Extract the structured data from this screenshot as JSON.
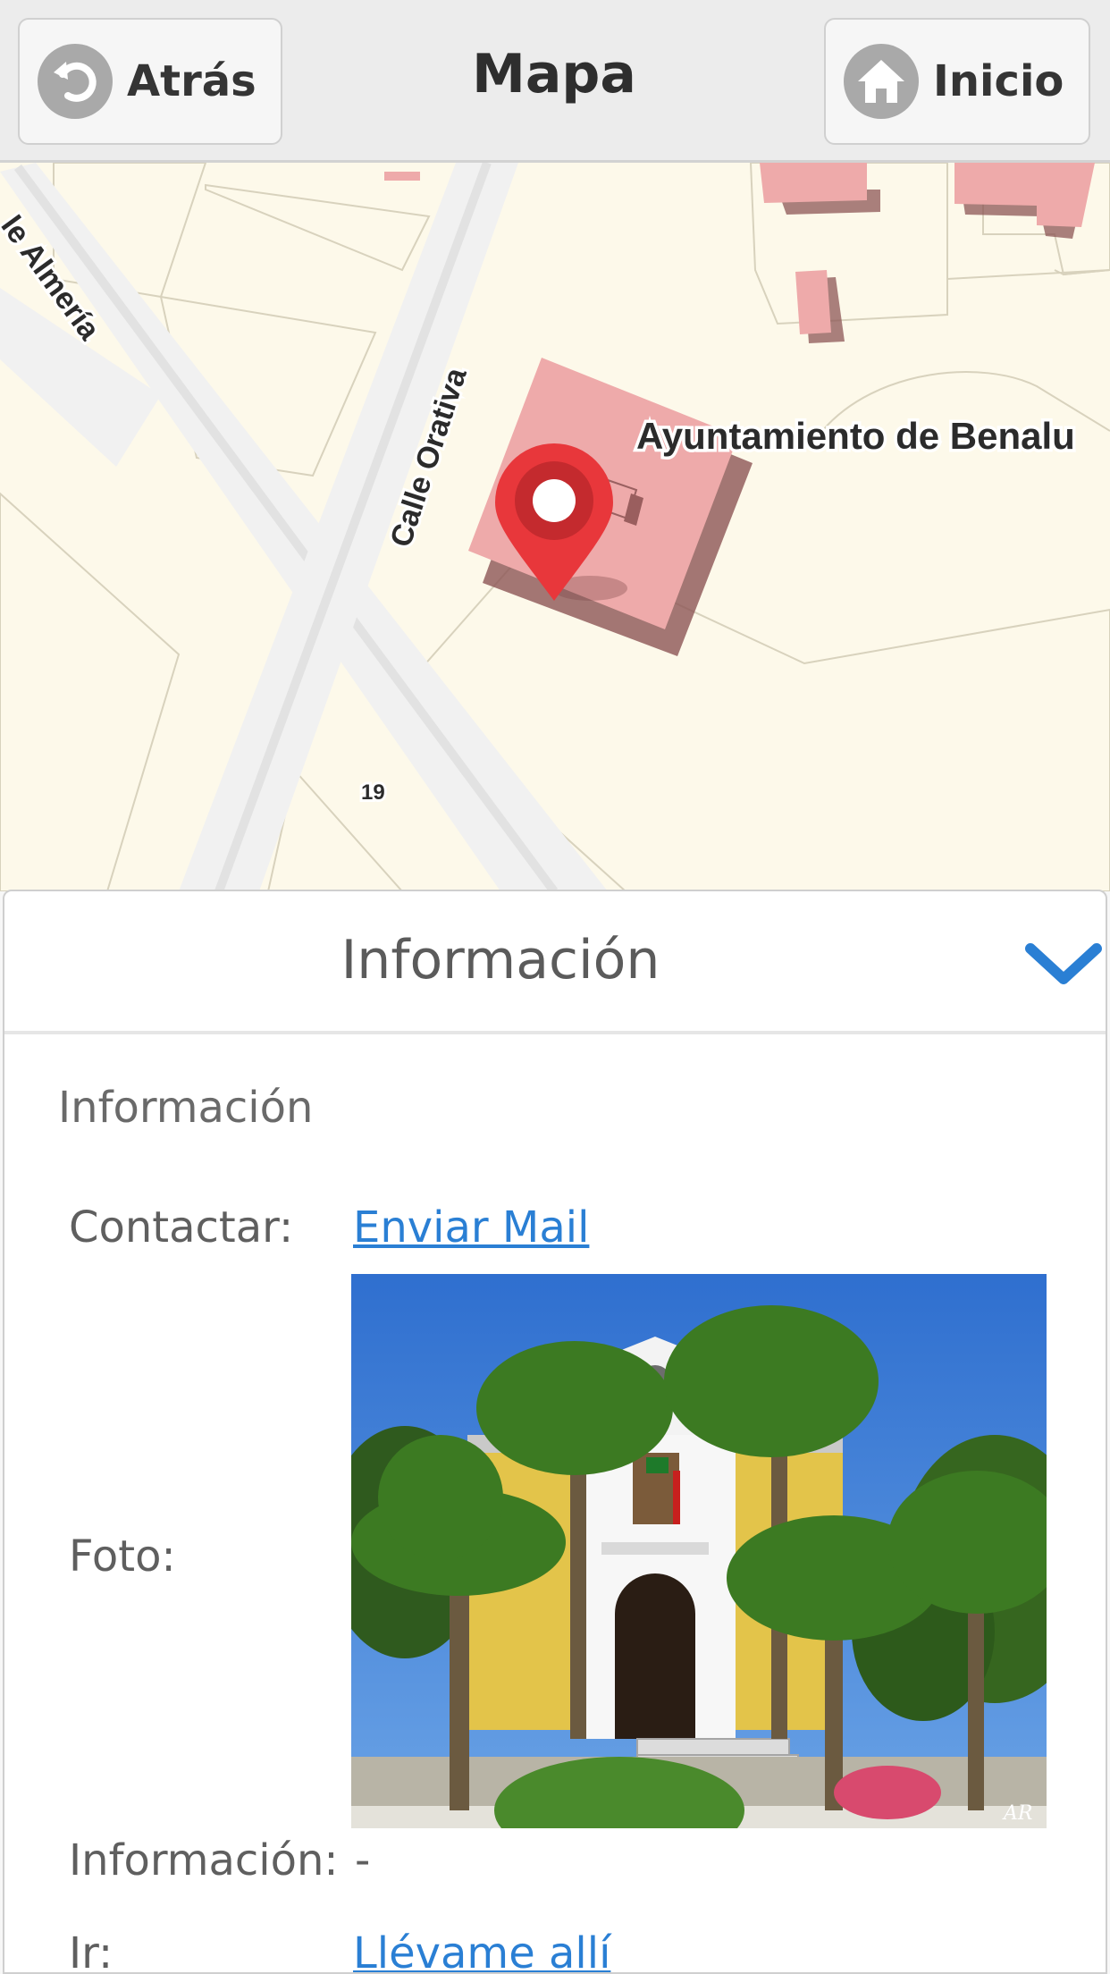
{
  "header": {
    "title": "Mapa",
    "back_label": "Atrás",
    "home_label": "Inicio"
  },
  "map": {
    "street_labels": [
      "Calle Orativa",
      "le Almería"
    ],
    "place_label": "Ayuntamiento de Benalu",
    "house_number": "19",
    "marker_color": "#e8373b"
  },
  "panel": {
    "title": "Información",
    "section_label": "Información",
    "rows": {
      "contact_label": "Contactar:",
      "contact_link": "Enviar Mail",
      "photo_label": "Foto:",
      "info_label": "Información:",
      "info_value": "-",
      "go_label": "Ir:",
      "go_link": "Llévame allí"
    },
    "photo_watermark": "AR"
  },
  "colors": {
    "accent": "#2a7fd4",
    "header_bg": "#ececec",
    "map_land": "#fdf9ea",
    "building": "#eeaaaa"
  }
}
